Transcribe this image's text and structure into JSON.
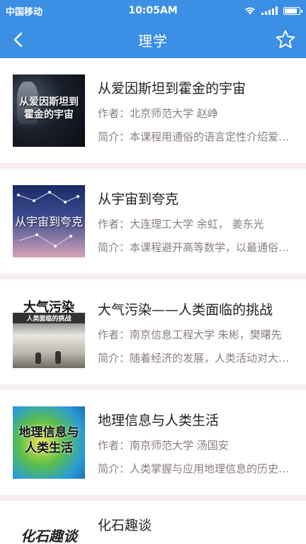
{
  "status": {
    "carrier": "中国移动",
    "time": "10:05AM"
  },
  "nav": {
    "title": "理学",
    "back_icon": "chevron-left-icon",
    "favorite_icon": "star-outline-icon"
  },
  "colors": {
    "primary": "#3b8fe4",
    "separator": "#f7eef0",
    "meta_text": "#8a7d80"
  },
  "courses": [
    {
      "title": "从爱因斯坦到霍金的宇宙",
      "author": "作者：北京师范大学 赵峥",
      "intro": "简介：本课程用通俗的语言定性介绍爱因斯坦到霍金的宇宙",
      "thumb_text": "从爱因斯坦到霍金的宇宙"
    },
    {
      "title": "从宇宙到夸克",
      "author": "作者：大连理工大学 余虹， 姜东光",
      "intro": "简介：本课程避开高等数学，以最通俗的方式介绍",
      "thumb_text": "从宇宙到夸克"
    },
    {
      "title": "大气污染——人类面临的挑战",
      "author": "作者：南京信息工程大学 朱彬，樊曙先",
      "intro": "简介：随着经济的发展，人类活动对大气环境的影响",
      "thumb_text": "大气污染",
      "thumb_subtext": "人类面临的挑战"
    },
    {
      "title": "地理信息与人类生活",
      "author": "作者：南京师范大学 汤国安",
      "intro": "简介：人类掌握与应用地理信息的历史悠久",
      "thumb_text": "地理信息与人类生活"
    },
    {
      "title": "化石趣谈",
      "thumb_text": "化石趣谈"
    }
  ]
}
